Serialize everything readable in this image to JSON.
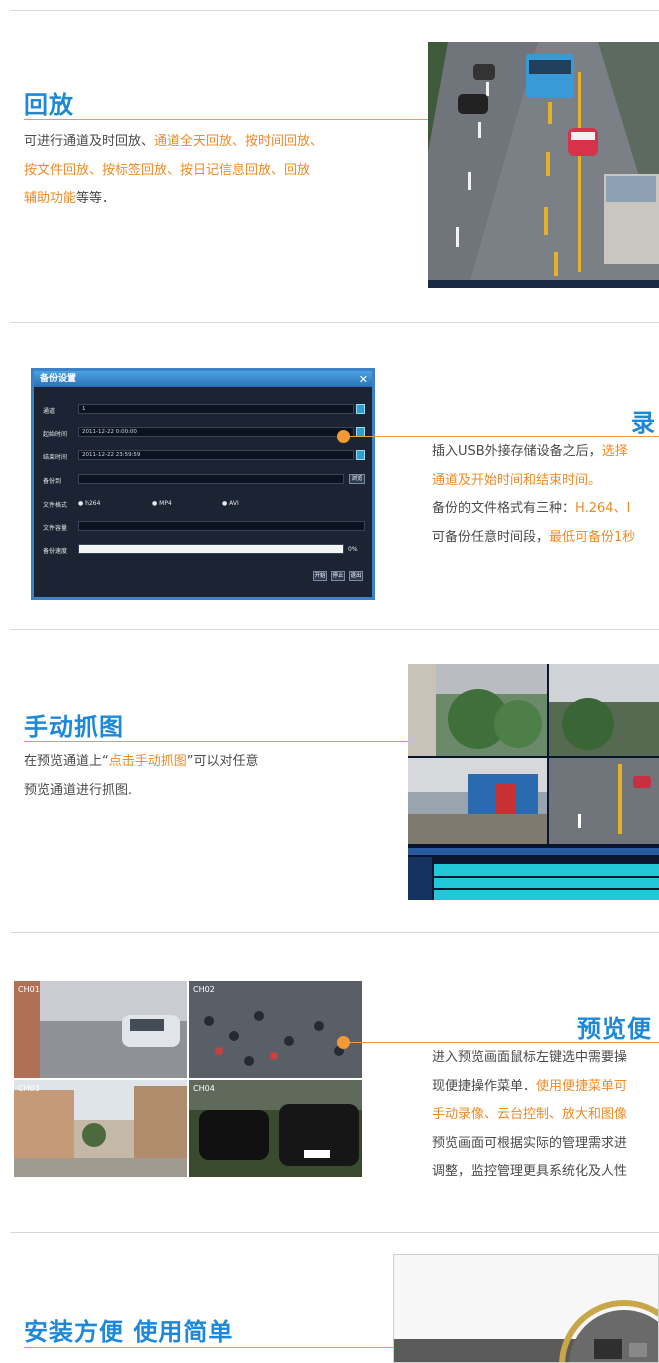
{
  "sections": {
    "playback": {
      "title": "回放",
      "desc": [
        [
          {
            "t": "可进行通道及时回放、",
            "hl": false
          },
          {
            "t": "通道全天回放、按时间回放、",
            "hl": true
          }
        ],
        [
          {
            "t": "按文件回放、按标签回放、按日记信息回放、回放",
            "hl": true
          }
        ],
        [
          {
            "t": "辅助功能",
            "hl": true
          },
          {
            "t": "等等．",
            "hl": false
          }
        ]
      ]
    },
    "backup": {
      "title": "录",
      "desc": [
        [
          {
            "t": "插入USB外接存储设备之后，",
            "hl": false
          },
          {
            "t": "选择",
            "hl": true
          }
        ],
        [
          {
            "t": "通道及开始时间和结束时间。",
            "hl": true
          }
        ],
        [
          {
            "t": "备份的文件格式有三种：",
            "hl": false
          },
          {
            "t": "H.264、I",
            "hl": true
          }
        ],
        [
          {
            "t": "可备份任意时间段，",
            "hl": false
          },
          {
            "t": "最低可备份1秒",
            "hl": true
          }
        ]
      ],
      "dialog": {
        "title": "备份设置",
        "close": "✕",
        "channel_label": "通道",
        "channel_value": "1",
        "start_label": "起始时间",
        "start_value": "2011-12-22 0:00:00",
        "end_label": "结束时间",
        "end_value": "2011-12-22 23:59:59",
        "backup_to_label": "备份到",
        "browse": "浏览",
        "format_label": "文件格式",
        "formats": [
          "h264",
          "MP4",
          "AVI"
        ],
        "capacity_label": "文件容量",
        "speed_label": "备份速度",
        "speed_value": "0%",
        "start_btn": "开始",
        "stop_btn": "停止",
        "exit_btn": "退出"
      }
    },
    "snapshot": {
      "title": "手动抓图",
      "desc": [
        [
          {
            "t": "在预览通道上“",
            "hl": false
          },
          {
            "t": "点击手动抓图",
            "hl": true
          },
          {
            "t": "”可以对任意",
            "hl": false
          }
        ],
        [
          {
            "t": "预览通道进行抓图.",
            "hl": false
          }
        ]
      ]
    },
    "preview": {
      "title": "预览便",
      "channels": [
        "CH01",
        "CH02",
        "CH03",
        "CH04"
      ],
      "desc": [
        [
          {
            "t": "进入预览画面鼠标左键选中需要操",
            "hl": false
          }
        ],
        [
          {
            "t": "现便捷操作菜单．",
            "hl": false
          },
          {
            "t": "使用便捷菜单可",
            "hl": true
          }
        ],
        [
          {
            "t": "手动录像、云台控制、放大和图像",
            "hl": true
          }
        ],
        [
          {
            "t": "预览画面可根据实际的管理需求进",
            "hl": false
          }
        ],
        [
          {
            "t": "调整，监控管理更具系统化及人性",
            "hl": false
          }
        ]
      ]
    },
    "install": {
      "title": "安装方便 使用简单"
    }
  },
  "colors": {
    "accent": "#f39a36",
    "title_blue": "#1e88d8",
    "text": "#4a4a4a",
    "divider": "#d9d9d9"
  }
}
